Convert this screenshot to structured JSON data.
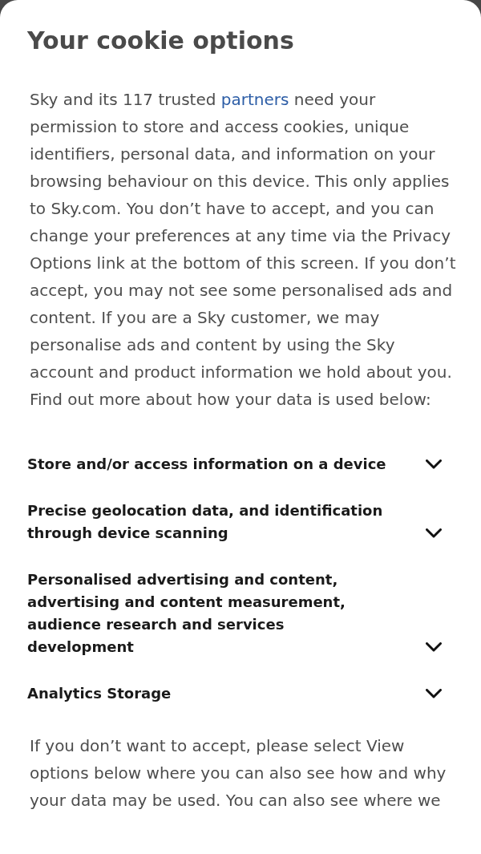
{
  "dialog": {
    "title": "Your cookie options"
  },
  "intro": {
    "text_before": "Sky and its 117 trusted ",
    "link": "partners",
    "text_after": " need your permission to store and access cookies, unique identifiers, personal data, and information on your browsing behaviour on this device. This only applies to Sky.com. You don’t have to accept, and you can change your preferences at any time via the Privacy Options link at the bottom of this screen. If you don’t accept, you may not see some personalised ads and content. If you are a Sky customer, we may personalise ads and content by using the Sky account and product information we hold about you. Find out more about how your data is used below:"
  },
  "purposes": [
    {
      "label": "Store and/or access information on a device",
      "expanded": false
    },
    {
      "label": "Precise geolocation data, and identification through device scanning",
      "expanded": false
    },
    {
      "label": "Personalised advertising and content, advertising and content measurement, audience research and services development",
      "expanded": false
    },
    {
      "label": "Analytics Storage",
      "expanded": false
    }
  ],
  "footer_text": "If you don’t want to accept, please select View options below where you can also see how and why your data may be used. You can also see where we"
}
